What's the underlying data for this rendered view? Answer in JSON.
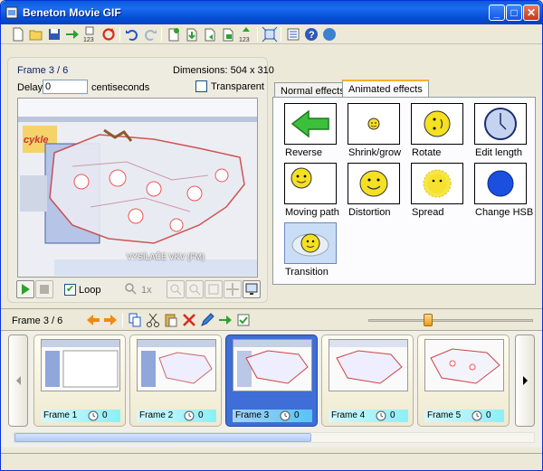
{
  "window": {
    "title": "Beneton Movie GIF",
    "title_icon": "film-strip-icon",
    "controls": [
      "minimize",
      "maximize",
      "close"
    ]
  },
  "toolbar": {
    "buttons": [
      {
        "name": "new-file-icon"
      },
      {
        "name": "open-folder-icon"
      },
      {
        "name": "save-icon"
      },
      {
        "name": "export-frames-icon"
      },
      {
        "name": "renumber-123-icon",
        "label": "123"
      },
      {
        "name": "loop-icon"
      },
      {
        "name": "undo-icon"
      },
      {
        "name": "redo-icon"
      },
      {
        "name": "add-frame-icon"
      },
      {
        "name": "insert-frame-icon"
      },
      {
        "name": "import-frame-icon"
      },
      {
        "name": "export-frame-icon"
      },
      {
        "name": "sort-frames-icon",
        "label": "123"
      },
      {
        "name": "fit-frames-icon"
      },
      {
        "name": "properties-icon"
      },
      {
        "name": "help-icon"
      },
      {
        "name": "web-icon"
      }
    ]
  },
  "preview": {
    "frame_label": "Frame 3 / 6",
    "dimensions_label": "Dimensions: 504 x 310",
    "delay_label": "Delay",
    "delay_value": "0",
    "delay_unit": "centiseconds",
    "transparent_label": "Transparent",
    "transparent_checked": false,
    "loop_label": "Loop",
    "loop_checked": true,
    "zoom_label": "1x",
    "map_caption": "VYSÍLAČE VKV (FM)",
    "site_logo": "cykle"
  },
  "effects": {
    "tabs": [
      {
        "label": "Normal effects",
        "active": false
      },
      {
        "label": "Animated effects",
        "active": true
      }
    ],
    "items": [
      {
        "label": "Reverse",
        "icon": "green-arrow-left-icon"
      },
      {
        "label": "Shrink/grow",
        "icon": "small-smiley-icon"
      },
      {
        "label": "Rotate",
        "icon": "rotated-smiley-icon"
      },
      {
        "label": "Edit length",
        "icon": "clock-icon"
      },
      {
        "label": "Moving path",
        "icon": "smiley-path-icon"
      },
      {
        "label": "Distortion",
        "icon": "wide-smiley-icon"
      },
      {
        "label": "Spread",
        "icon": "scattered-smiley-icon"
      },
      {
        "label": "Change HSB",
        "icon": "blue-circle-icon"
      },
      {
        "label": "Transition",
        "icon": "cloud-smiley-icon"
      }
    ]
  },
  "framebar": {
    "label": "Frame 3 / 6",
    "tools": [
      "move-left-icon",
      "move-right-icon",
      "copy-icon",
      "cut-icon",
      "paste-icon",
      "delete-icon",
      "edit-icon",
      "export-icon",
      "check-icon"
    ]
  },
  "frames": [
    {
      "label": "Frame 1",
      "delay": "0",
      "active": false
    },
    {
      "label": "Frame 2",
      "delay": "0",
      "active": false
    },
    {
      "label": "Frame 3",
      "delay": "0",
      "active": true
    },
    {
      "label": "Frame 4",
      "delay": "0",
      "active": false
    },
    {
      "label": "Frame 5",
      "delay": "0",
      "active": false
    }
  ],
  "colors": {
    "titlebar": "#0a5bd8",
    "active_frame": "#3e6ed6",
    "tab_highlight": "#f6b128"
  }
}
